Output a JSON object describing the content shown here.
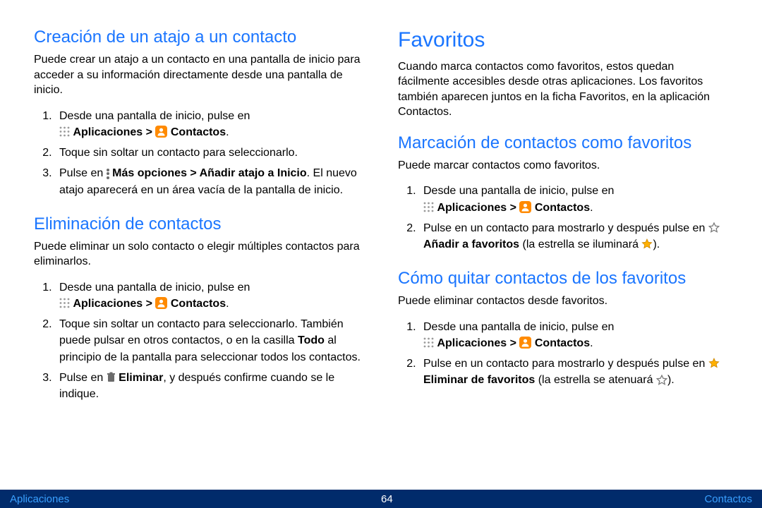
{
  "left": {
    "h1": "Creación de un atajo a un contacto",
    "p1": "Puede crear un atajo a un contacto en una pantalla de inicio para acceder a su información directamente desde una pantalla de inicio.",
    "s1_li1_a": "Desde una pantalla de inicio, pulse en",
    "s1_li1_apps": "Aplicaciones >",
    "s1_li1_cont": "Contactos",
    "s1_li2": "Toque sin soltar un contacto para seleccionarlo.",
    "s1_li3_a": "Pulse en",
    "s1_li3_b": "Más opciones > Añadir atajo a Inicio",
    "s1_li3_c": ". El nuevo atajo aparecerá en un área vacía de la pantalla de inicio.",
    "h2": "Eliminación de contactos",
    "p2": "Puede eliminar un solo contacto o elegir múltiples contactos para eliminarlos.",
    "s2_li1_a": "Desde una pantalla de inicio, pulse en",
    "s2_li1_apps": "Aplicaciones >",
    "s2_li1_cont": "Contactos",
    "s2_li2_a": "Toque sin soltar un contacto para seleccionarlo. También puede pulsar en otros contactos, o en la casilla ",
    "s2_li2_b": "Todo",
    "s2_li2_c": " al principio de la pantalla para seleccionar todos los contactos.",
    "s2_li3_a": "Pulse en",
    "s2_li3_b": "Eliminar",
    "s2_li3_c": ", y después confirme cuando se le indique."
  },
  "right": {
    "h1": "Favoritos",
    "p1": "Cuando marca contactos como favoritos, estos quedan fácilmente accesibles desde otras aplicaciones. Los favoritos también aparecen juntos en la ficha Favoritos, en la aplicación Contactos.",
    "h2": "Marcación de contactos como favoritos",
    "p2": "Puede marcar contactos como favoritos.",
    "s1_li1_a": "Desde una pantalla de inicio, pulse en",
    "s1_li1_apps": "Aplicaciones >",
    "s1_li1_cont": "Contactos",
    "s1_li2_a": "Pulse en un contacto para mostrarlo y después pulse en",
    "s1_li2_b": "Añadir  a favoritos",
    "s1_li2_c": "(la estrella se iluminará",
    "s1_li2_d": ").",
    "h3": "Cómo quitar contactos de los favoritos",
    "p3": "Puede eliminar contactos desde favoritos.",
    "s2_li1_a": "Desde una pantalla de inicio, pulse en",
    "s2_li1_apps": "Aplicaciones >",
    "s2_li1_cont": "Contactos",
    "s2_li2_a": "Pulse en un contacto para mostrarlo y después pulse en",
    "s2_li2_b": "Eliminar de favoritos",
    "s2_li2_c": "(la estrella se atenuará",
    "s2_li2_d": ")."
  },
  "footer": {
    "left": "Aplicaciones",
    "center": "64",
    "right": "Contactos"
  }
}
